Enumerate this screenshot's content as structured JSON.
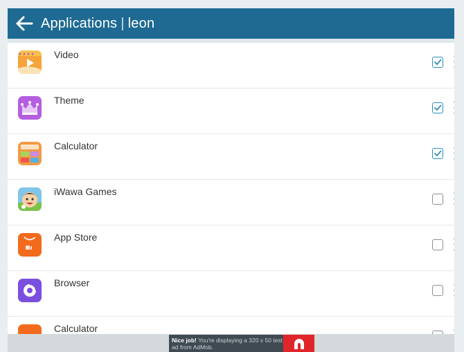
{
  "header": {
    "title": "Applications",
    "separator": "|",
    "user": "leon"
  },
  "apps": [
    {
      "name": "Video",
      "checked": true,
      "icon": "video-app-icon"
    },
    {
      "name": "Theme",
      "checked": true,
      "icon": "theme-app-icon"
    },
    {
      "name": "Calculator",
      "checked": true,
      "icon": "calculator-app-icon"
    },
    {
      "name": "iWawa Games",
      "checked": false,
      "icon": "iwawa-games-app-icon"
    },
    {
      "name": "App Store",
      "checked": false,
      "icon": "app-store-icon"
    },
    {
      "name": "Browser",
      "checked": false,
      "icon": "browser-app-icon"
    },
    {
      "name": "Calculator",
      "checked": false,
      "icon": "calculator-app-icon"
    }
  ],
  "ad": {
    "headline": "Nice job!",
    "body": "You're displaying a 320 x 50 test ad from AdMob."
  },
  "colors": {
    "header_bg": "#1e6a93",
    "checkbox_checked": "#2b8fc2",
    "ad_logo": "#e0262a"
  }
}
